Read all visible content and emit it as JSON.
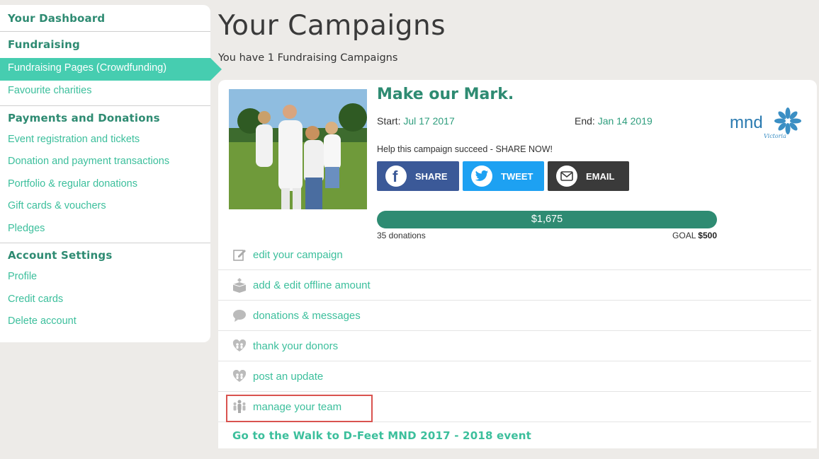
{
  "sidebar": {
    "sections": [
      {
        "heading": "Your Dashboard",
        "items": []
      },
      {
        "heading": "Fundraising",
        "items": [
          "Fundraising Pages (Crowdfunding)",
          "Favourite charities"
        ]
      },
      {
        "heading": "Payments and Donations",
        "items": [
          "Event registration and tickets",
          "Donation and payment transactions",
          "Portfolio & regular donations",
          "Gift cards & vouchers",
          "Pledges"
        ]
      },
      {
        "heading": "Account Settings",
        "items": [
          "Profile",
          "Credit cards",
          "Delete account"
        ]
      }
    ],
    "active_item": "Fundraising Pages (Crowdfunding)"
  },
  "page": {
    "title": "Your Campaigns",
    "subtitle": "You have 1 Fundraising Campaigns"
  },
  "campaign": {
    "title": "Make our Mark.",
    "start_label": "Start:",
    "start_date": "Jul 17 2017",
    "end_label": "End:",
    "end_date": "Jan 14 2019",
    "logo_text": "mnd",
    "logo_sub": "Victoria",
    "share_prompt": "Help this campaign succeed - SHARE NOW!",
    "share_buttons": {
      "facebook": "SHARE",
      "twitter": "TWEET",
      "email": "EMAIL"
    },
    "raised": "$1,675",
    "progress_fraction": 1.0,
    "donations": "35 donations",
    "goal_label": "GOAL",
    "goal_value": "$500",
    "actions": [
      "edit your campaign",
      "add & edit offline amount",
      "donations & messages",
      "thank your donors",
      "post an update",
      "manage your team"
    ],
    "event_link": "Go to the Walk to D-Feet MND 2017 - 2018 event"
  },
  "colors": {
    "accent": "#2e8b72",
    "link": "#3cbf9c",
    "active": "#46cdb0",
    "highlight": "#d9534f"
  }
}
